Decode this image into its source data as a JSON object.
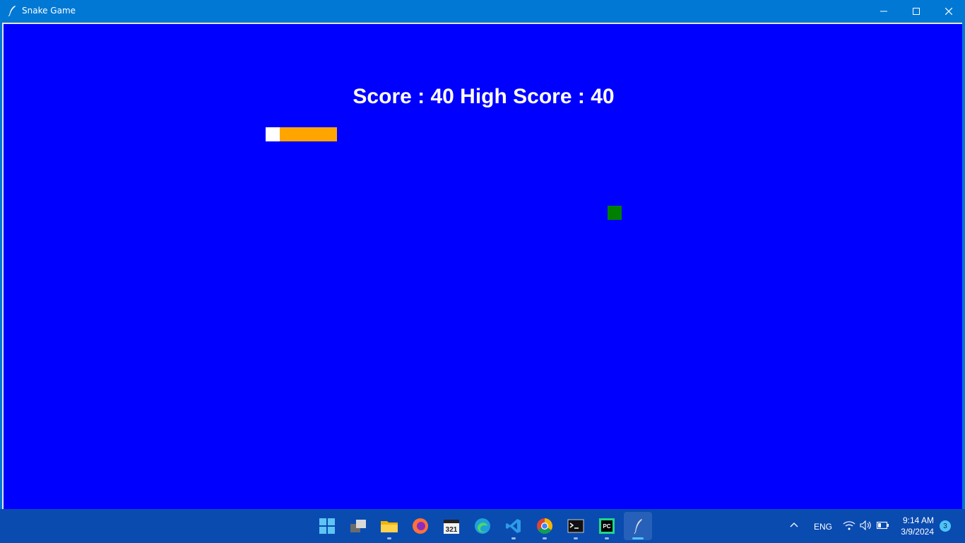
{
  "window": {
    "title": "Snake Game",
    "controls": [
      "minimize",
      "maximize",
      "close"
    ]
  },
  "game": {
    "score_text": "Score : 40 High Score : 40",
    "colors": {
      "background": "#0000ff",
      "snake_head": "#ffffff",
      "snake_body": "#ffa500",
      "food": "#008000"
    }
  },
  "taskbar": {
    "apps": [
      "start-icon",
      "task-view-icon",
      "file-explorer-icon",
      "firefox-icon",
      "calendar-321-icon",
      "edge-icon",
      "vscode-icon",
      "chrome-icon",
      "terminal-icon",
      "pycharm-icon",
      "feather-icon"
    ],
    "tray": {
      "language": "ENG",
      "time": "9:14 AM",
      "date": "3/9/2024",
      "notifications": "3"
    }
  }
}
